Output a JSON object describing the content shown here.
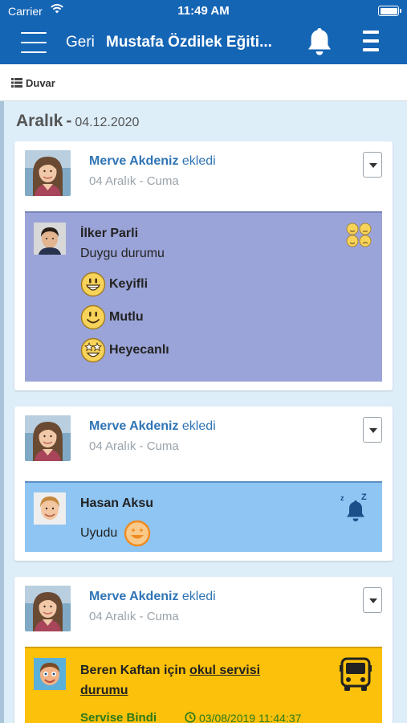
{
  "status": {
    "carrier": "Carrier",
    "time": "11:49 AM"
  },
  "nav": {
    "back_label": "Geri",
    "title": "Mustafa Özdilek Eğiti..."
  },
  "subbar": {
    "label": "Duvar"
  },
  "section": {
    "month": "Aralık",
    "separator": "-",
    "date": "04.12.2020"
  },
  "posts": [
    {
      "author": "Merve Akdeniz",
      "action": "ekledi",
      "date": "04 Aralık - Cuma",
      "child": "İlker Parli",
      "subtitle": "Duygu durumu",
      "moods": [
        {
          "label": "Keyifli",
          "icon": "grin-face-icon"
        },
        {
          "label": "Mutlu",
          "icon": "smile-face-icon"
        },
        {
          "label": "Heyecanlı",
          "icon": "star-eyes-face-icon"
        }
      ],
      "panel_color": "#9ba4d8",
      "panel_icon": "moods-icon"
    },
    {
      "author": "Merve Akdeniz",
      "action": "ekledi",
      "date": "04 Aralık - Cuma",
      "child": "Hasan Aksu",
      "status_text": "Uyudu",
      "panel_color": "#8ec5f3",
      "panel_icon": "sleep-bell-icon",
      "status_icon": "smile-outline-icon"
    },
    {
      "author": "Merve Akdeniz",
      "action": "ekledi",
      "date": "04 Aralık - Cuma",
      "child_prefix": "Beren Kaftan için",
      "link_text": "okul servisi durumu",
      "status_text": "Servise Bindi",
      "timestamp": "03/08/2019 11:44:37",
      "panel_color": "#fcc10a",
      "panel_icon": "bus-icon",
      "status_color": "#2b7a1c"
    }
  ]
}
